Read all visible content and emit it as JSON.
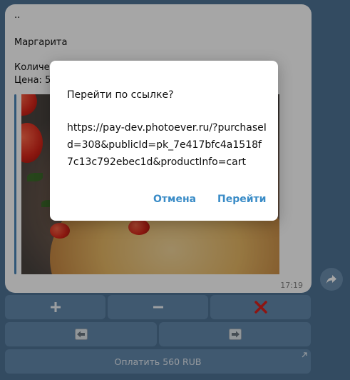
{
  "message": {
    "line_dots": "..",
    "product": "Маргарита",
    "qty_partial": "Количес",
    "price_partial": "Цена: 56",
    "time": "17:19"
  },
  "keyboard": {
    "plus": "+",
    "minus": "−",
    "remove": "✕",
    "prev": "←",
    "next": "→",
    "pay_label": "Оплатить 560 RUB"
  },
  "dialog": {
    "title": "Перейти по ссылке?",
    "url": "https://pay-dev.photoever.ru/?purchaseId=308&publicId=pk_7e417bfc4a1518f7c13c792ebec1d&productInfo=cart",
    "cancel_label": "Отмена",
    "go_label": "Перейти"
  },
  "colors": {
    "background": "#4f7396",
    "accent": "#3a8cc7",
    "remove": "#d9211c"
  }
}
